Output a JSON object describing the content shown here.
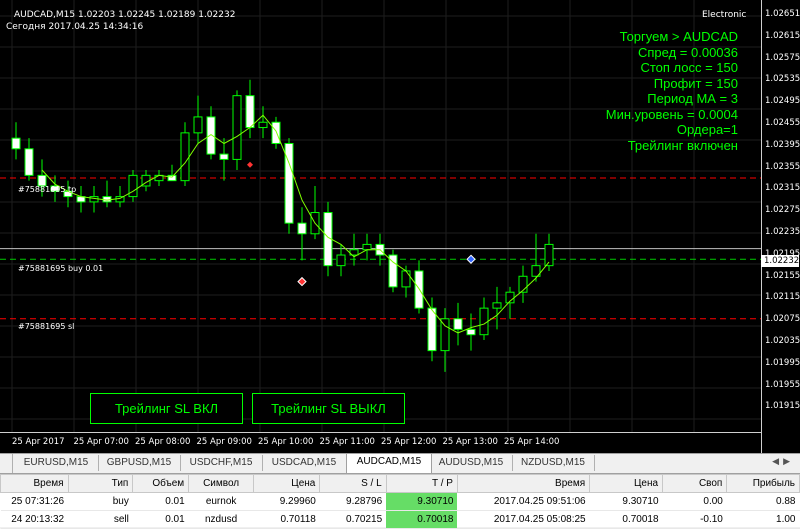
{
  "header": {
    "symbol_line": "AUDCAD,M15  1.02203 1.02245 1.02189 1.02232",
    "date_line": "Сегодня 2017.04.25 14:34:16",
    "broker": "Electronic"
  },
  "price_axis": {
    "ticks": [
      "1.02651",
      "1.02615",
      "1.02575",
      "1.02535",
      "1.02495",
      "1.02455",
      "1.02395",
      "1.02355",
      "1.02315",
      "1.02275",
      "1.02235",
      "1.02195",
      "1.02155",
      "1.02115",
      "1.02075",
      "1.02035",
      "1.01995",
      "1.01955",
      "1.01915"
    ],
    "current_price": "1.02232"
  },
  "time_axis": {
    "ticks": [
      "25 Apr 2017",
      "25 Apr 07:00",
      "25 Apr 08:00",
      "25 Apr 09:00",
      "25 Apr 10:00",
      "25 Apr 11:00",
      "25 Apr 12:00",
      "25 Apr 13:00",
      "25 Apr 14:00"
    ]
  },
  "info_panel": {
    "lines": [
      "Торгуем  > AUDCAD",
      "Спред = 0.00036",
      "Стоп лосс = 150",
      "Профит = 150",
      "Период МА =  3",
      "Мин.уровень = 0.0004",
      "Ордера=1",
      "Трейлинг включен"
    ]
  },
  "levels": {
    "tp_label": "#75881695 tp",
    "buy_label": "#75881695 buy 0.01",
    "sl_label": "#75881695 sl"
  },
  "buttons": {
    "trailing_on": "Трейлинг SL ВКЛ",
    "trailing_off": "Трейлинг SL ВЫКЛ"
  },
  "tabs": [
    "EURUSD,M15",
    "GBPUSD,M15",
    "USDCHF,M15",
    "USDCAD,M15",
    "AUDCAD,M15",
    "AUDUSD,M15",
    "NZDUSD,M15"
  ],
  "active_tab": "AUDCAD,M15",
  "orders": {
    "headers": [
      "Время",
      "Тип",
      "Объем",
      "Символ",
      "Цена",
      "S / L",
      "T / P",
      "Время",
      "Цена",
      "Своп",
      "Прибыль"
    ],
    "rows": [
      [
        "25 07:31:26",
        "buy",
        "0.01",
        "eurnok",
        "9.29960",
        "9.28796",
        "9.30710",
        "2017.04.25 09:51:06",
        "9.30710",
        "0.00",
        "0.88"
      ],
      [
        "24 20:13:32",
        "sell",
        "0.01",
        "nzdusd",
        "0.70118",
        "0.70215",
        "0.70018",
        "2017.04.25 05:08:25",
        "0.70018",
        "-0.10",
        "1.00"
      ]
    ]
  },
  "colors": {
    "bull": "#ffffff",
    "bear": "#00ff00",
    "ma": "#7fff00",
    "tp_line": "#ff0000",
    "sl_line": "#ff0000",
    "buy_line": "#00cc00",
    "bid_line": "#c0c0c0"
  },
  "chart_data": {
    "type": "candlestick",
    "symbol": "AUDCAD",
    "timeframe": "M15",
    "ylim": [
      1.019,
      1.0267
    ],
    "candles": [
      {
        "o": 1.0244,
        "h": 1.0247,
        "l": 1.024,
        "c": 1.0242
      },
      {
        "o": 1.0242,
        "h": 1.0244,
        "l": 1.0236,
        "c": 1.0237
      },
      {
        "o": 1.0237,
        "h": 1.024,
        "l": 1.0233,
        "c": 1.0235
      },
      {
        "o": 1.0235,
        "h": 1.0237,
        "l": 1.0232,
        "c": 1.0234
      },
      {
        "o": 1.0234,
        "h": 1.0236,
        "l": 1.0231,
        "c": 1.0233
      },
      {
        "o": 1.0233,
        "h": 1.0235,
        "l": 1.023,
        "c": 1.0232
      },
      {
        "o": 1.0232,
        "h": 1.0235,
        "l": 1.023,
        "c": 1.0233
      },
      {
        "o": 1.0233,
        "h": 1.0236,
        "l": 1.0231,
        "c": 1.0232
      },
      {
        "o": 1.0232,
        "h": 1.0235,
        "l": 1.0231,
        "c": 1.0233
      },
      {
        "o": 1.0233,
        "h": 1.0238,
        "l": 1.0232,
        "c": 1.0237
      },
      {
        "o": 1.0235,
        "h": 1.0238,
        "l": 1.0234,
        "c": 1.0237
      },
      {
        "o": 1.0236,
        "h": 1.0238,
        "l": 1.0235,
        "c": 1.0237
      },
      {
        "o": 1.0237,
        "h": 1.0239,
        "l": 1.0236,
        "c": 1.0236
      },
      {
        "o": 1.0236,
        "h": 1.0247,
        "l": 1.0235,
        "c": 1.0245
      },
      {
        "o": 1.0245,
        "h": 1.0252,
        "l": 1.0243,
        "c": 1.0248
      },
      {
        "o": 1.0248,
        "h": 1.025,
        "l": 1.024,
        "c": 1.0241
      },
      {
        "o": 1.0241,
        "h": 1.0244,
        "l": 1.0236,
        "c": 1.024
      },
      {
        "o": 1.024,
        "h": 1.0253,
        "l": 1.0238,
        "c": 1.0252
      },
      {
        "o": 1.0252,
        "h": 1.0255,
        "l": 1.0244,
        "c": 1.0246
      },
      {
        "o": 1.0246,
        "h": 1.025,
        "l": 1.0244,
        "c": 1.0247
      },
      {
        "o": 1.0247,
        "h": 1.0248,
        "l": 1.0242,
        "c": 1.0243
      },
      {
        "o": 1.0243,
        "h": 1.0244,
        "l": 1.0226,
        "c": 1.0228
      },
      {
        "o": 1.0228,
        "h": 1.0231,
        "l": 1.0221,
        "c": 1.0226
      },
      {
        "o": 1.0226,
        "h": 1.0235,
        "l": 1.0225,
        "c": 1.023
      },
      {
        "o": 1.023,
        "h": 1.0232,
        "l": 1.0218,
        "c": 1.022
      },
      {
        "o": 1.022,
        "h": 1.0224,
        "l": 1.0218,
        "c": 1.0222
      },
      {
        "o": 1.0222,
        "h": 1.0226,
        "l": 1.022,
        "c": 1.0223
      },
      {
        "o": 1.0223,
        "h": 1.0226,
        "l": 1.0221,
        "c": 1.0224
      },
      {
        "o": 1.0224,
        "h": 1.0226,
        "l": 1.022,
        "c": 1.0222
      },
      {
        "o": 1.0222,
        "h": 1.0223,
        "l": 1.0215,
        "c": 1.0216
      },
      {
        "o": 1.0216,
        "h": 1.022,
        "l": 1.0214,
        "c": 1.0219
      },
      {
        "o": 1.0219,
        "h": 1.0221,
        "l": 1.0211,
        "c": 1.0212
      },
      {
        "o": 1.0212,
        "h": 1.0214,
        "l": 1.0202,
        "c": 1.0204
      },
      {
        "o": 1.0204,
        "h": 1.0212,
        "l": 1.02,
        "c": 1.021
      },
      {
        "o": 1.021,
        "h": 1.0213,
        "l": 1.0205,
        "c": 1.0208
      },
      {
        "o": 1.0208,
        "h": 1.0211,
        "l": 1.0204,
        "c": 1.0207
      },
      {
        "o": 1.0207,
        "h": 1.0214,
        "l": 1.0206,
        "c": 1.0212
      },
      {
        "o": 1.0212,
        "h": 1.0216,
        "l": 1.0208,
        "c": 1.0213
      },
      {
        "o": 1.0213,
        "h": 1.0216,
        "l": 1.021,
        "c": 1.0215
      },
      {
        "o": 1.0215,
        "h": 1.022,
        "l": 1.0213,
        "c": 1.0218
      },
      {
        "o": 1.0218,
        "h": 1.0226,
        "l": 1.0217,
        "c": 1.022
      },
      {
        "o": 1.022,
        "h": 1.0226,
        "l": 1.0219,
        "c": 1.0224
      }
    ],
    "ma_period": 3,
    "levels": {
      "tp": 1.02365,
      "buy": 1.02212,
      "sl": 1.021,
      "bid": 1.02232
    }
  }
}
